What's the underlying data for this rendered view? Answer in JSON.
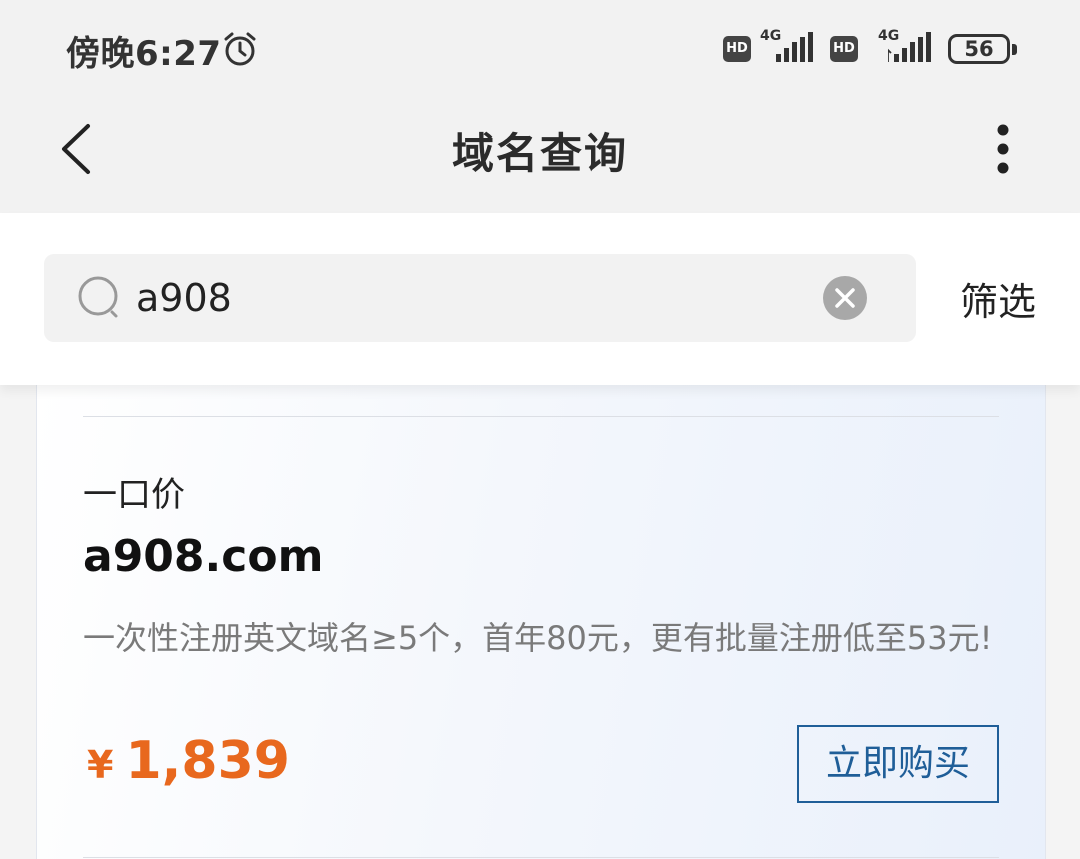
{
  "status_bar": {
    "time": "傍晚6:27",
    "alarm_icon": "alarm-clock-icon",
    "sim1": {
      "hd": "HD",
      "network": "4G"
    },
    "sim2": {
      "hd": "HD",
      "network": "4G"
    },
    "battery": "56"
  },
  "nav": {
    "back_icon": "chevron-left-icon",
    "title": "域名查询",
    "more_icon": "more-vertical-icon"
  },
  "search": {
    "icon": "search-icon",
    "value": "a908",
    "clear_icon": "clear-icon",
    "filter_label": "筛选"
  },
  "result": {
    "type_label": "一口价",
    "domain": "a908.com",
    "promo": "一次性注册英文域名≥5个，首年80元，更有批量注册低至53元!",
    "currency_symbol": "¥",
    "price": "1,839",
    "buy_label": "立即购买"
  },
  "colors": {
    "price": "#e8681e",
    "buy_button": "#1f5e98",
    "background": "#f2f2f2"
  }
}
